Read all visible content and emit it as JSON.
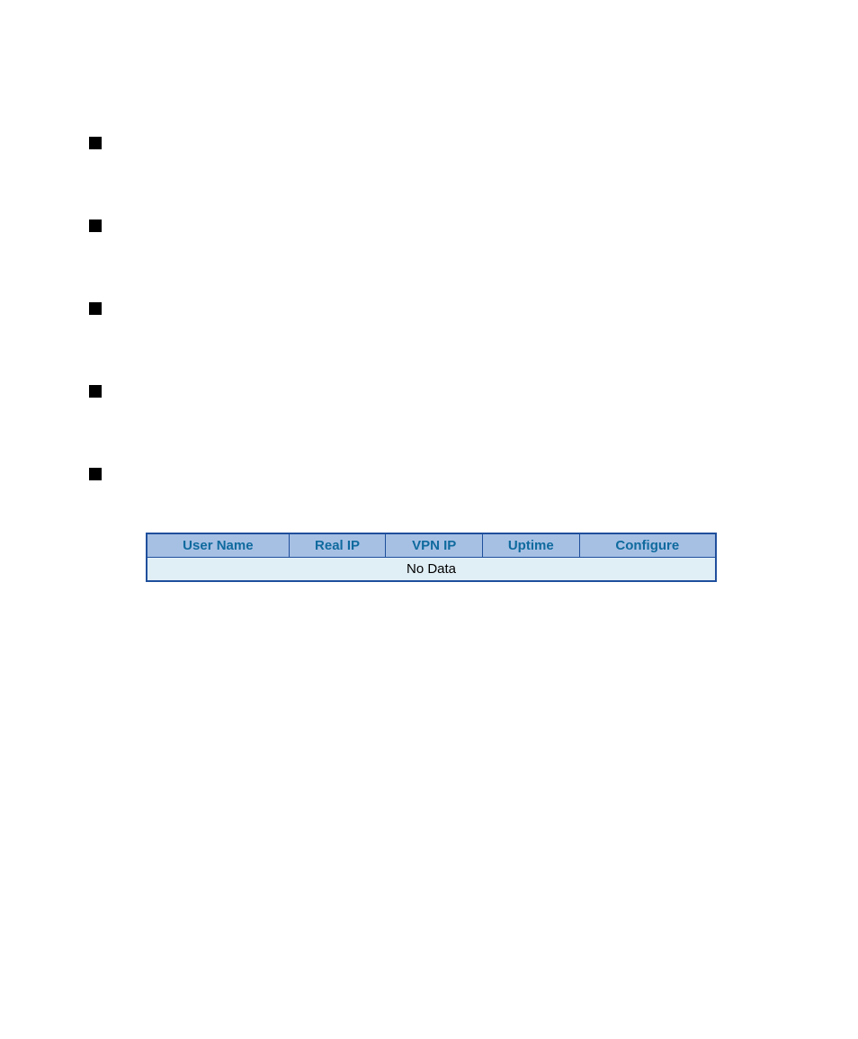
{
  "bullets": [
    {
      "label": ""
    },
    {
      "label": ""
    },
    {
      "label": ""
    },
    {
      "label": ""
    },
    {
      "label": ""
    }
  ],
  "table": {
    "headers": [
      "User Name",
      "Real IP",
      "VPN IP",
      "Uptime",
      "Configure"
    ],
    "nodata": "No Data"
  }
}
